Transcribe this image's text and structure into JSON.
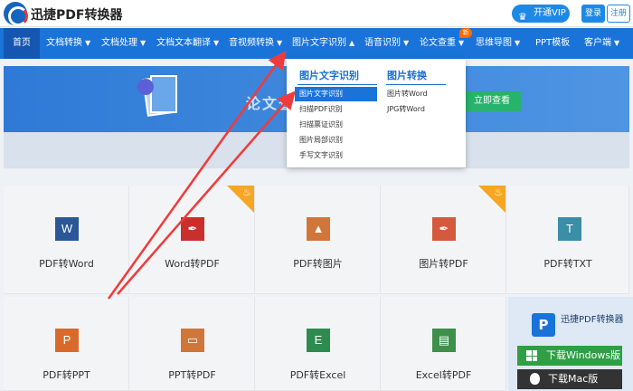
{
  "colors": {
    "brand": "#1a73d9",
    "nav_active": "#1557b0",
    "download_win": "#2ea043",
    "hot": "#f6a623",
    "annotation_arrow": "#ef3b3b"
  },
  "header": {
    "app_name": "迅捷PDF转换器",
    "vip_label": "开通VIP",
    "login_label": "登录",
    "register_label": "注册"
  },
  "nav": {
    "items": [
      {
        "label": "首页",
        "has_caret": false
      },
      {
        "label": "文档转换",
        "has_caret": true
      },
      {
        "label": "文档处理",
        "has_caret": true
      },
      {
        "label": "文档文本翻译",
        "has_caret": true
      },
      {
        "label": "音视频转换",
        "has_caret": true
      },
      {
        "label": "图片文字识别",
        "has_caret": true
      },
      {
        "label": "语音识别",
        "has_caret": true
      },
      {
        "label": "论文查重",
        "has_caret": true
      },
      {
        "label": "思维导图",
        "has_caret": true
      },
      {
        "label": "PPT模板",
        "has_caret": false
      },
      {
        "label": "客户端",
        "has_caret": true
      }
    ],
    "new_badge": "新"
  },
  "banner": {
    "title": "论文查",
    "button_label": "立即查看"
  },
  "dropdown": {
    "col1_heading": "图片文字识别",
    "col1_items": [
      "图片文字识别",
      "扫描PDF识别",
      "扫描票证识别",
      "图片局部识别",
      "手写文字识别"
    ],
    "col2_heading": "图片转换",
    "col2_items": [
      "图片转Word",
      "JPG转Word"
    ]
  },
  "tiles": [
    {
      "label": "PDF转Word",
      "icon_text": "W",
      "icon_color": "#2b5797",
      "icon": "word-file-icon",
      "hot": false
    },
    {
      "label": "Word转PDF",
      "icon_text": "✒",
      "icon_color": "#c9302c",
      "icon": "pdf-file-icon",
      "hot": true
    },
    {
      "label": "PDF转图片",
      "icon_text": "▲",
      "icon_color": "#d0763a",
      "icon": "image-file-icon",
      "hot": false
    },
    {
      "label": "图片转PDF",
      "icon_text": "✒",
      "icon_color": "#d35a3c",
      "icon": "pdf-file-icon",
      "hot": true
    },
    {
      "label": "PDF转TXT",
      "icon_text": "T",
      "icon_color": "#3a8ea5",
      "icon": "txt-file-icon",
      "hot": false
    },
    {
      "label": "PDF转PPT",
      "icon_text": "P",
      "icon_color": "#d86b2c",
      "icon": "ppt-file-icon",
      "hot": false
    },
    {
      "label": "PPT转PDF",
      "icon_text": "▭",
      "icon_color": "#d0763a",
      "icon": "slide-file-icon",
      "hot": false
    },
    {
      "label": "PDF转Excel",
      "icon_text": "E",
      "icon_color": "#2e8b4f",
      "icon": "excel-file-icon",
      "hot": false
    },
    {
      "label": "Excel转PDF",
      "icon_text": "▤",
      "icon_color": "#3d8f4a",
      "icon": "pdf-file-icon",
      "hot": false
    }
  ],
  "promo": {
    "logo_text": "P",
    "name": "迅捷PDF转换器",
    "download_windows": "下载Windows版",
    "download_mac": "下载Mac版"
  }
}
